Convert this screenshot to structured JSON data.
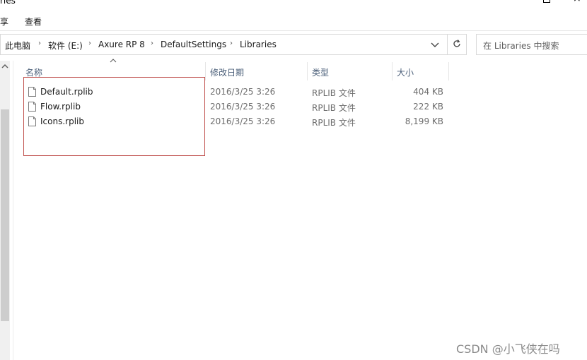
{
  "window": {
    "title": "ries"
  },
  "ribbon": {
    "tabs": [
      "享",
      "查看"
    ]
  },
  "address": {
    "crumbs": [
      "此电脑",
      "软件 (E:)",
      "Axure RP 8",
      "DefaultSettings",
      "Libraries"
    ],
    "separator": "›"
  },
  "search": {
    "placeholder": "在 Libraries 中搜索"
  },
  "columns": [
    "名称",
    "修改日期",
    "类型",
    "大小"
  ],
  "files": [
    {
      "name": "Default.rplib",
      "modified": "2016/3/25 3:26",
      "type": "RPLIB 文件",
      "size": "404 KB"
    },
    {
      "name": "Flow.rplib",
      "modified": "2016/3/25 3:26",
      "type": "RPLIB 文件",
      "size": "222 KB"
    },
    {
      "name": "Icons.rplib",
      "modified": "2016/3/25 3:26",
      "type": "RPLIB 文件",
      "size": "8,199 KB"
    }
  ],
  "watermark": "CSDN @小飞侠在吗",
  "colors": {
    "highlight": "#c0504d",
    "header_text": "#4c607a"
  }
}
